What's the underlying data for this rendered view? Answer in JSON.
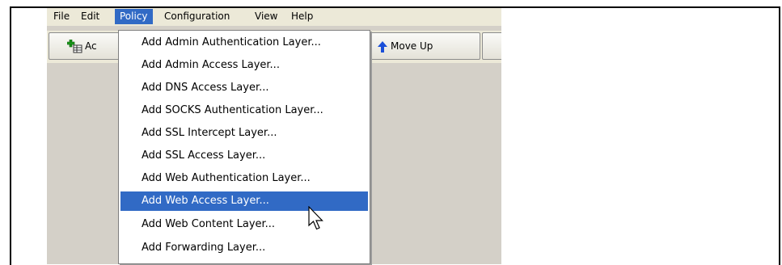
{
  "menubar": {
    "items": [
      {
        "label": "File"
      },
      {
        "label": "Edit"
      },
      {
        "label": "Policy",
        "active": true
      },
      {
        "label": "Configuration"
      },
      {
        "label": "View"
      },
      {
        "label": "Help"
      }
    ]
  },
  "toolbar": {
    "add_button_label": "Ac",
    "move_up_label": "Move Up"
  },
  "policy_menu": {
    "items": [
      {
        "label": "Add Admin Authentication Layer..."
      },
      {
        "label": "Add Admin Access Layer..."
      },
      {
        "label": "Add DNS Access Layer..."
      },
      {
        "label": "Add SOCKS Authentication Layer..."
      },
      {
        "label": "Add SSL Intercept Layer..."
      },
      {
        "label": "Add SSL Access Layer..."
      },
      {
        "label": "Add Web Authentication Layer..."
      },
      {
        "label": "Add Web Access Layer...",
        "highlighted": true
      },
      {
        "label": "Add Web Content Layer..."
      },
      {
        "label": "Add Forwarding Layer..."
      }
    ]
  },
  "colors": {
    "highlight": "#316ac5",
    "window_bg": "#d4d0c8",
    "menubar_bg": "#ece9d8"
  }
}
